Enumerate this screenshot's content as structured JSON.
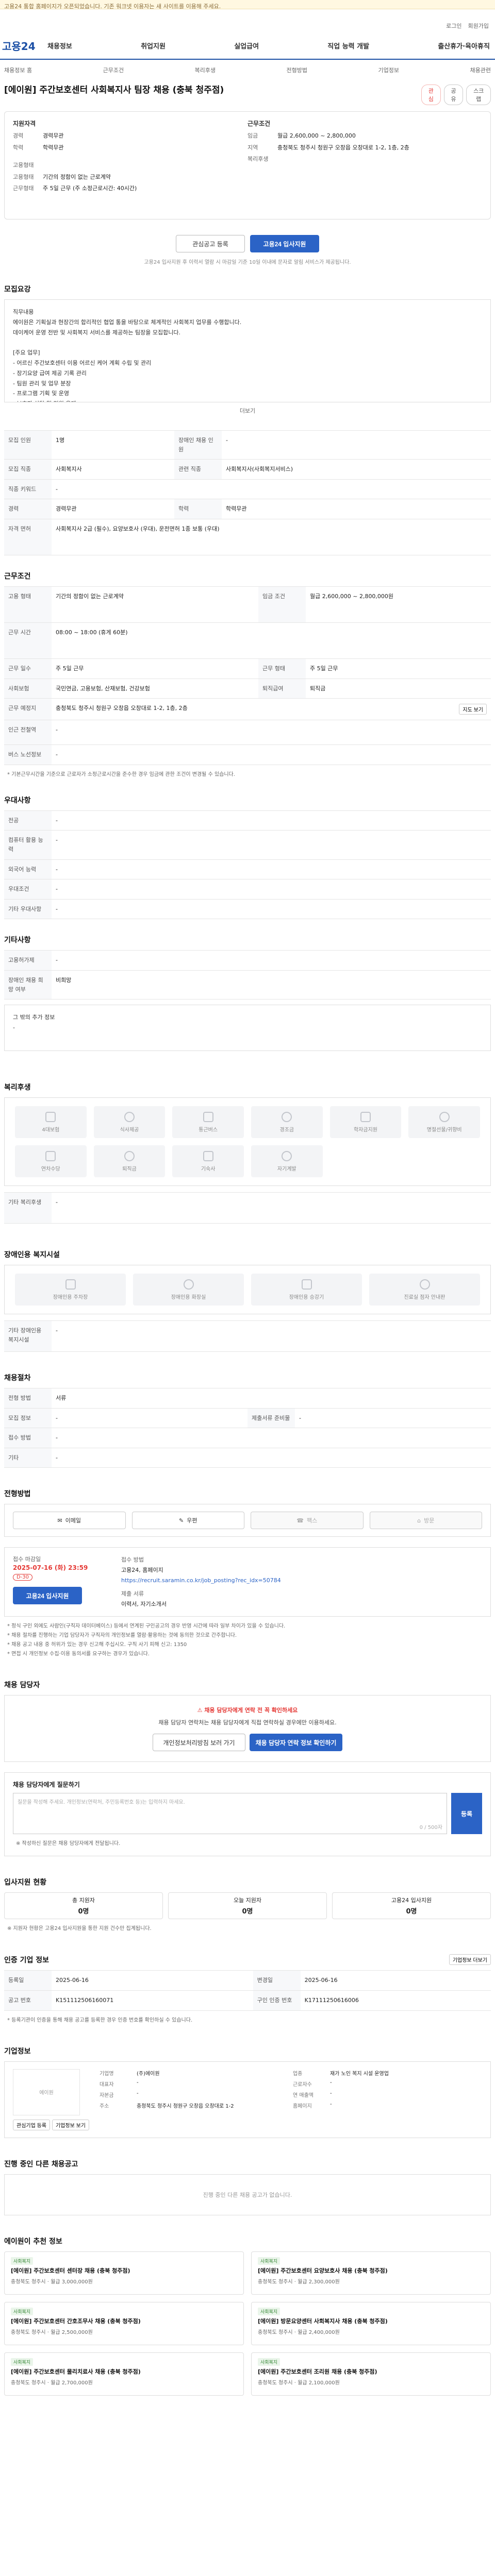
{
  "notice": "고용24 통합 홈페이지가 오픈되었습니다. 기존 워크넷 이용자는 새 사이트를 이용해 주세요.",
  "util": [
    "로그인",
    "회원가입"
  ],
  "logo": "고용24",
  "gnb": [
    "채용정보",
    "취업지원",
    "실업급여",
    "직업 능력 개발",
    "출산휴가·육아휴직"
  ],
  "sub_tabs": [
    "채용정보 홈",
    "근무조건",
    "복리후생",
    "전형방법",
    "기업정보",
    "채용관련"
  ],
  "job": {
    "title": "[에이원] 주간보호센터 사회복지사 팀장 채용 (충북 청주점)",
    "actions": [
      "관심",
      "공유",
      "스크랩"
    ]
  },
  "summary": {
    "left_head": "지원자격",
    "left_rows": [
      {
        "k": "경력",
        "v": "경력무관"
      },
      {
        "k": "학력",
        "v": "학력무관"
      },
      {
        "k": "고용형태",
        "v": ""
      },
      {
        "k": "고용형태",
        "v": "기간의 정함이 없는 근로계약"
      },
      {
        "k": "근무형태",
        "v": "주 5일 근무 (주 소정근로시간: 40시간)"
      }
    ],
    "right_head": "근무조건",
    "right_rows": [
      {
        "k": "임금",
        "v": "월급 2,600,000 ~ 2,800,000"
      },
      {
        "k": "지역",
        "v": "충청북도 청주시 청원구 오창읍 오창대로 1-2, 1층, 2층"
      },
      {
        "k": "복리후생",
        "v": ""
      }
    ]
  },
  "apply": {
    "scrap_btn": "관심공고 등록",
    "apply_btn": "고용24 입사지원",
    "hint": "고용24 입사지원 후 이력서 열람 시 마감일 기준 10일 이내에 문자로 알림 서비스가 제공됩니다."
  },
  "duties": {
    "title": "모집요강",
    "text": "직무내용\n에이원은 기획실과 현장간의 합리적인 협업 통을 바탕으로 체계적인 사회복지 업무를 수행합니다.\n데이케어 운영 전반 및 사회복지 서비스를 제공하는 팀장을 모집합니다.\n\n[주요 업무]\n- 어르신 주간보호센터 이용 어르신 케어 계획 수립 및 관리\n- 장기요양 급여 제공 기록 관리\n- 팀원 관리 및 업무 분장\n- 프로그램 기획 및 운영\n- 보호자 상담 및 민원 응대",
    "more": "더보기"
  },
  "recruit_table": [
    {
      "k": "모집 인원",
      "v": "1명",
      "k2": "장애인 채용 인원",
      "v2": "-"
    },
    {
      "k": "모집 직종",
      "v": "사회복지사",
      "k2": "관련 직종",
      "v2": "사회복지사(사회복지서비스)"
    },
    {
      "k": "직종 키워드",
      "v": "-",
      "k2": "",
      "v2": ""
    },
    {
      "k": "경력",
      "v": "경력무관",
      "k2": "학력",
      "v2": "학력무관"
    },
    {
      "k": "자격 면허",
      "v": "사회복지사 2급 (필수), 요양보호사 (우대), 운전면허 1종 보통 (우대)",
      "k2": "",
      "v2": ""
    }
  ],
  "work_cond": {
    "title": "근무조건",
    "rows": [
      {
        "k": "고용 형태",
        "v": "기간의 정함이 없는 근로계약",
        "k2": "임금 조건",
        "v2": "월급 2,600,000 ~ 2,800,000원"
      },
      {
        "k": "근무 시간",
        "v": "08:00 ~ 18:00 (휴게 60분)",
        "k2": "",
        "v2": ""
      },
      {
        "k": "근무 일수",
        "v": "주 5일 근무",
        "k2": "근무 형태",
        "v2": "주 5일 근무"
      },
      {
        "k": "사회보험",
        "v": "국민연금, 고용보험, 산재보험, 건강보험",
        "k2": "퇴직급여",
        "v2": "퇴직금"
      },
      {
        "k": "근무 예정지",
        "v": "충청북도 청주시 청원구 오창읍 오창대로 1-2, 1층, 2층",
        "k2": "",
        "v2": ""
      },
      {
        "k": "인근 전철역",
        "v": "-",
        "k2": "",
        "v2": ""
      },
      {
        "k": "버스 노선정보",
        "v": "-",
        "k2": "",
        "v2": ""
      }
    ],
    "map_btn": "지도 보기",
    "note": "* 기본근무시간을 기준으로 근로자가 소정근로시간을 준수한 경우 임금에 관한 조건이 변경될 수 있습니다."
  },
  "prefs": {
    "title": "우대사항",
    "rows": [
      {
        "k": "전공",
        "v": "-"
      },
      {
        "k": "컴퓨터 활용 능력",
        "v": "-"
      },
      {
        "k": "외국어 능력",
        "v": "-"
      },
      {
        "k": "우대조건",
        "v": "-"
      },
      {
        "k": "기타 우대사항",
        "v": "-"
      }
    ]
  },
  "etc": {
    "title": "기타사항",
    "rows": [
      {
        "k": "고용허가제",
        "v": "-"
      },
      {
        "k": "장애인 채용 희망 여부",
        "v": "비희망"
      }
    ],
    "extra": "그 밖의 추가 정보\n-"
  },
  "welfare": {
    "title": "복리후생",
    "items": [
      "4대보험",
      "식사제공",
      "통근버스",
      "경조금",
      "학자금지원",
      "명절선물/귀향비",
      "연차수당",
      "퇴직금",
      "기숙사",
      "자기계발"
    ],
    "etc_label": "기타 복리후생",
    "etc_value": "-"
  },
  "accessibility": {
    "title": "장애인용 복지시설",
    "items": [
      "장애인용 주차장",
      "장애인용 화장실",
      "장애인용 승강기",
      "진료실 점자 안내판"
    ],
    "etc_label": "기타 장애인용 복지시설",
    "etc_value": "-"
  },
  "hiring_proc": {
    "title": "채용절차",
    "rows": [
      {
        "k": "전형 방법",
        "v": "서류",
        "k2": "",
        "v2": ""
      },
      {
        "k": "모집 정보",
        "v": "-",
        "k2": "제출서류 준비물",
        "v2": "-"
      },
      {
        "k": "접수 방법",
        "v": "-",
        "k2": "",
        "v2": ""
      },
      {
        "k": "기타",
        "v": "-",
        "k2": "",
        "v2": ""
      }
    ]
  },
  "method": {
    "title": "전형방법",
    "items": [
      {
        "label": "이메일",
        "on": true
      },
      {
        "label": "우편",
        "on": true
      },
      {
        "label": "팩스",
        "on": false
      },
      {
        "label": "방문",
        "on": false
      }
    ]
  },
  "deadline": {
    "label": "접수 마감일",
    "date": "2025-07-16 (화) 23:59",
    "dday": "D-30",
    "apply_btn": "고용24 입사지원",
    "method_label": "접수 방법",
    "method_value": "고용24, 홈페이지",
    "url": "https://recruit.saramin.co.kr/job_posting?rec_idx=50784",
    "docs_label": "제출 서류",
    "docs_value": "이력서, 자기소개서"
  },
  "notes": [
    "* 정식 구인 외에도 사람인(구직자 데이터베이스) 등에서 연계된 구인공고의 경우 반영 시간에 따라 일부 차이가 있을 수 있습니다.",
    "* 채용 절차를 진행하는 기업 담당자가 구직자의 개인정보를 열람·활용하는 것에 동의한 것으로 간주합니다.",
    "* 채용 공고 내용 중 허위가 있는 경우 신고해 주십시오. 구직 사기 피해 신고: 1350",
    "* 면접 시 개인정보 수집·이용 동의서를 요구하는 경우가 있습니다."
  ],
  "contact": {
    "title": "채용 담당자",
    "warn": "채용 담당자에게 연락 전 꼭 확인하세요",
    "text": "채용 담당자 연락처는 채용 담당자에게 직접 연락하실 경우에만 이용하세요.",
    "btn1": "개인정보처리방침 보러 가기",
    "btn2": "채용 담당자 연락 정보 확인하기"
  },
  "qa": {
    "title": "채용 담당자에게 질문하기",
    "placeholder": "질문을 작성해 주세요. 개인정보(연락처, 주민등록번호 등)는 입력하지 마세요.",
    "count": "0 / 500자",
    "submit": "등록",
    "notes": "※ 작성하신 질문은 채용 담당자에게 전달됩니다."
  },
  "stats": {
    "title": "입사지원 현황",
    "total_label": "총 지원자",
    "total": "0명",
    "today_label": "오늘 지원자",
    "today": "0명",
    "view_label": "고용24 입사지원",
    "view": "0명",
    "note": "※ 지원자 현황은 고용24 입사지원을 통한 지원 건수만 집계됩니다."
  },
  "recruit_info": {
    "title": "인증 기업 정보",
    "btn": "기업정보 더보기",
    "rows": [
      {
        "k": "등록일",
        "v": "2025-06-16",
        "k2": "변경일",
        "v2": "2025-06-16"
      },
      {
        "k": "공고 번호",
        "v": "K151112506160071",
        "k2": "구인 인증 번호",
        "v2": "K17111250616006"
      }
    ],
    "note": "* 등록기관이 인증을 통해 채용 공고를 등록한 경우 인증 번호를 확인하실 수 있습니다."
  },
  "company": {
    "title": "기업정보",
    "logo": "에이원",
    "rows": [
      {
        "k": "기업명",
        "v": "(주)에이원",
        "k2": "업종",
        "v2": "재가 노인 복지 시설 운영업"
      },
      {
        "k": "대표자",
        "v": "-",
        "k2": "근로자수",
        "v2": "-"
      },
      {
        "k": "자본금",
        "v": "-",
        "k2": "연 매출액",
        "v2": "-"
      },
      {
        "k": "주소",
        "v": "충청북도 청주시 청원구 오창읍 오창대로 1-2",
        "k2": "홈페이지",
        "v2": "-"
      }
    ],
    "btns": [
      "관심기업 등록",
      "기업정보 보기"
    ]
  },
  "other_jobs": {
    "title": "진행 중인 다른 채용공고",
    "empty": "진행 중인 다른 채용 공고가 없습니다."
  },
  "recommend": {
    "title": "에이원이 추천 정보",
    "cards": [
      {
        "tag": "사회복지",
        "title": "[에이원] 주간보호센터 센터장 채용 (충북 청주점)",
        "meta": "충청북도 청주시 · 월급 3,000,000원"
      },
      {
        "tag": "사회복지",
        "title": "[에이원] 주간보호센터 요양보호사 채용 (충북 청주점)",
        "meta": "충청북도 청주시 · 월급 2,300,000원"
      },
      {
        "tag": "사회복지",
        "title": "[에이원] 주간보호센터 간호조무사 채용 (충북 청주점)",
        "meta": "충청북도 청주시 · 월급 2,500,000원"
      },
      {
        "tag": "사회복지",
        "title": "[에이원] 방문요양센터 사회복지사 채용 (충북 청주점)",
        "meta": "충청북도 청주시 · 월급 2,400,000원"
      },
      {
        "tag": "사회복지",
        "title": "[에이원] 주간보호센터 물리치료사 채용 (충북 청주점)",
        "meta": "충청북도 청주시 · 월급 2,700,000원"
      },
      {
        "tag": "사회복지",
        "title": "[에이원] 주간보호센터 조리원 채용 (충북 청주점)",
        "meta": "충청북도 청주시 · 월급 2,100,000원"
      }
    ]
  }
}
